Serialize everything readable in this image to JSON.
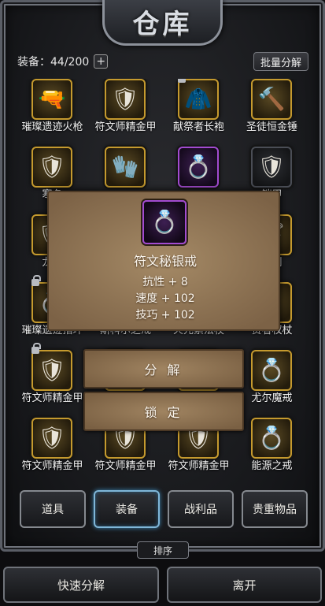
{
  "title": "仓库",
  "header": {
    "capacity": "装备：44/200",
    "plus_icon": "+",
    "batch_label": "批量分解"
  },
  "items": [
    {
      "name": "璀璨遗迹火枪",
      "icon": "rifle-icon",
      "glyph": "🔫",
      "frame": "gold",
      "locked": false
    },
    {
      "name": "符文师精金甲",
      "icon": "armor-icon",
      "glyph": "🛡",
      "frame": "gold",
      "locked": false
    },
    {
      "name": "献祭者长袍",
      "icon": "robe-icon",
      "glyph": "🧥",
      "frame": "gold",
      "locked": true
    },
    {
      "name": "圣徒恒金锤",
      "icon": "hammer-icon",
      "glyph": "🔨",
      "frame": "gold",
      "locked": false
    },
    {
      "name": "寒冬",
      "icon": "armor-icon",
      "glyph": "🛡",
      "frame": "gold",
      "locked": false
    },
    {
      "name": "",
      "icon": "gauntlet-icon",
      "glyph": "🧤",
      "frame": "gold",
      "locked": false
    },
    {
      "name": "",
      "icon": "ring-icon",
      "glyph": "💍",
      "frame": "purple",
      "locked": false
    },
    {
      "name": "铠甲",
      "icon": "breastplate-icon",
      "glyph": "🛡",
      "frame": "dim",
      "locked": false
    },
    {
      "name": "龙鳞",
      "icon": "armor-icon",
      "glyph": "🛡",
      "frame": "gold",
      "locked": false
    },
    {
      "name": "",
      "icon": "blank-icon",
      "glyph": "",
      "frame": "gold",
      "locked": false
    },
    {
      "name": "",
      "icon": "blank-icon",
      "glyph": "",
      "frame": "gold",
      "locked": false
    },
    {
      "name": "尖刺",
      "icon": "spike-icon",
      "glyph": "🗡",
      "frame": "gold",
      "locked": false
    },
    {
      "name": "璀璨遗迹指环",
      "icon": "ring-icon",
      "glyph": "💍",
      "frame": "gold",
      "locked": true
    },
    {
      "name": "斯科尔之戒",
      "icon": "ring-icon",
      "glyph": "💍",
      "frame": "gold",
      "locked": false
    },
    {
      "name": "火元素法杖",
      "icon": "staff-icon",
      "glyph": "🪄",
      "frame": "gold",
      "locked": false
    },
    {
      "name": "贤者权杖",
      "icon": "scepter-icon",
      "glyph": "⚚",
      "frame": "gold",
      "locked": false
    },
    {
      "name": "符文师精金甲",
      "icon": "armor-icon",
      "glyph": "🛡",
      "frame": "gold",
      "locked": true
    },
    {
      "name": "",
      "icon": "blank-icon",
      "glyph": "",
      "frame": "gold",
      "locked": false
    },
    {
      "name": "",
      "icon": "blank-icon",
      "glyph": "",
      "frame": "gold",
      "locked": false
    },
    {
      "name": "尤尔魔戒",
      "icon": "ring-icon",
      "glyph": "💍",
      "frame": "gold",
      "locked": false
    },
    {
      "name": "符文师精金甲",
      "icon": "armor-icon",
      "glyph": "🛡",
      "frame": "gold",
      "locked": false
    },
    {
      "name": "符文师精金甲",
      "icon": "armor-icon",
      "glyph": "🛡",
      "frame": "gold",
      "locked": false
    },
    {
      "name": "符文师精金甲",
      "icon": "armor-icon",
      "glyph": "🛡",
      "frame": "gold",
      "locked": false
    },
    {
      "name": "能源之戒",
      "icon": "ring-icon",
      "glyph": "💍",
      "frame": "gold",
      "locked": false
    }
  ],
  "tooltip": {
    "icon": "ring-icon",
    "name": "符文秘银戒",
    "stats": [
      "抗性 + 8",
      "速度 + 102",
      "技巧 + 102"
    ]
  },
  "actions": {
    "decompose": "分 解",
    "lock": "锁 定"
  },
  "tabs": [
    {
      "label": "道具",
      "active": false
    },
    {
      "label": "装备",
      "active": true
    },
    {
      "label": "战利品",
      "active": false
    },
    {
      "label": "贵重物品",
      "active": false
    }
  ],
  "sort_label": "排序",
  "bottom": {
    "quick_decompose": "快速分解",
    "leave": "离开"
  }
}
